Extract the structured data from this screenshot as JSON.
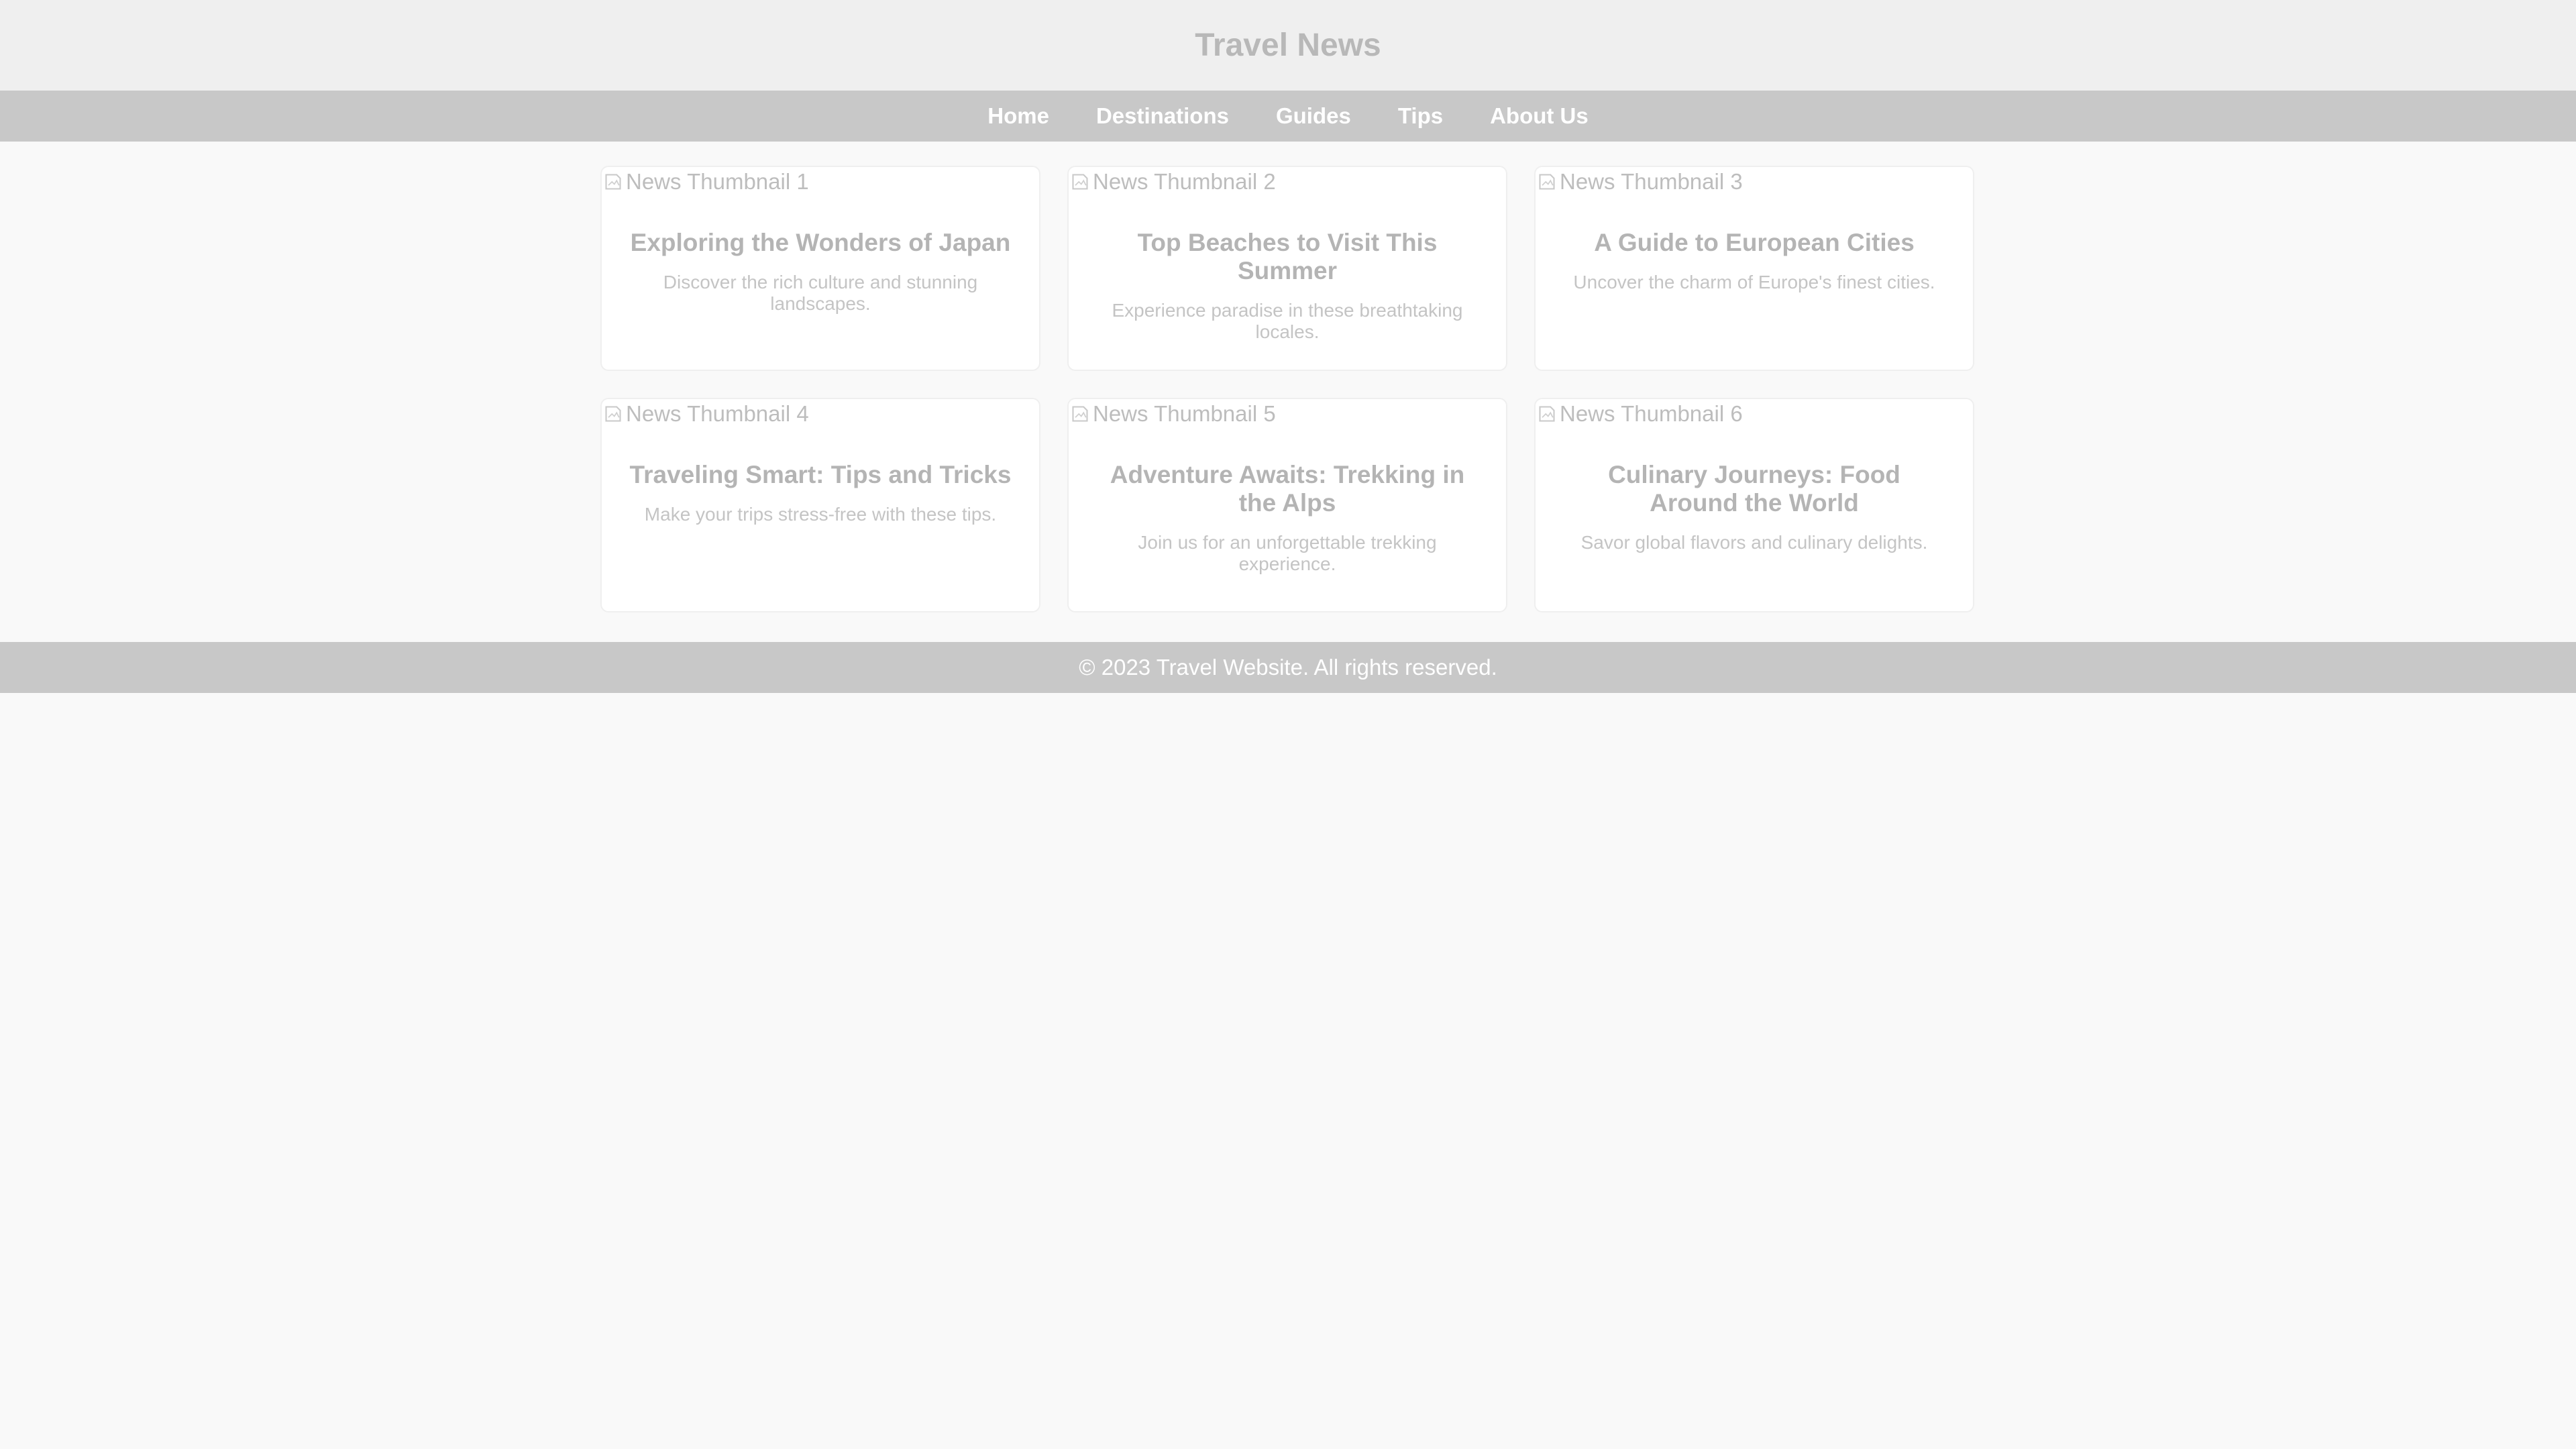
{
  "header": {
    "title": "Travel News"
  },
  "nav": {
    "items": [
      {
        "label": "Home"
      },
      {
        "label": "Destinations"
      },
      {
        "label": "Guides"
      },
      {
        "label": "Tips"
      },
      {
        "label": "About Us"
      }
    ]
  },
  "articles": [
    {
      "thumb_alt": "News Thumbnail 1",
      "title": "Exploring the Wonders of Japan",
      "description": "Discover the rich culture and stunning landscapes."
    },
    {
      "thumb_alt": "News Thumbnail 2",
      "title": "Top Beaches to Visit This Summer",
      "description": "Experience paradise in these breathtaking locales."
    },
    {
      "thumb_alt": "News Thumbnail 3",
      "title": "A Guide to European Cities",
      "description": "Uncover the charm of Europe's finest cities."
    },
    {
      "thumb_alt": "News Thumbnail 4",
      "title": "Traveling Smart: Tips and Tricks",
      "description": "Make your trips stress-free with these tips."
    },
    {
      "thumb_alt": "News Thumbnail 5",
      "title": "Adventure Awaits: Trekking in the Alps",
      "description": "Join us for an unforgettable trekking experience."
    },
    {
      "thumb_alt": "News Thumbnail 6",
      "title": "Culinary Journeys: Food Around the World",
      "description": "Savor global flavors and culinary delights."
    }
  ],
  "footer": {
    "text": "© 2023 Travel Website. All rights reserved."
  },
  "icons": {
    "broken_image": "broken-image-icon"
  },
  "colors": {
    "header_bg": "#efefef",
    "nav_bg": "#c8c8c8",
    "footer_bg": "#c8c8c8",
    "page_bg": "#f9f9f9",
    "card_bg": "#ffffff"
  }
}
